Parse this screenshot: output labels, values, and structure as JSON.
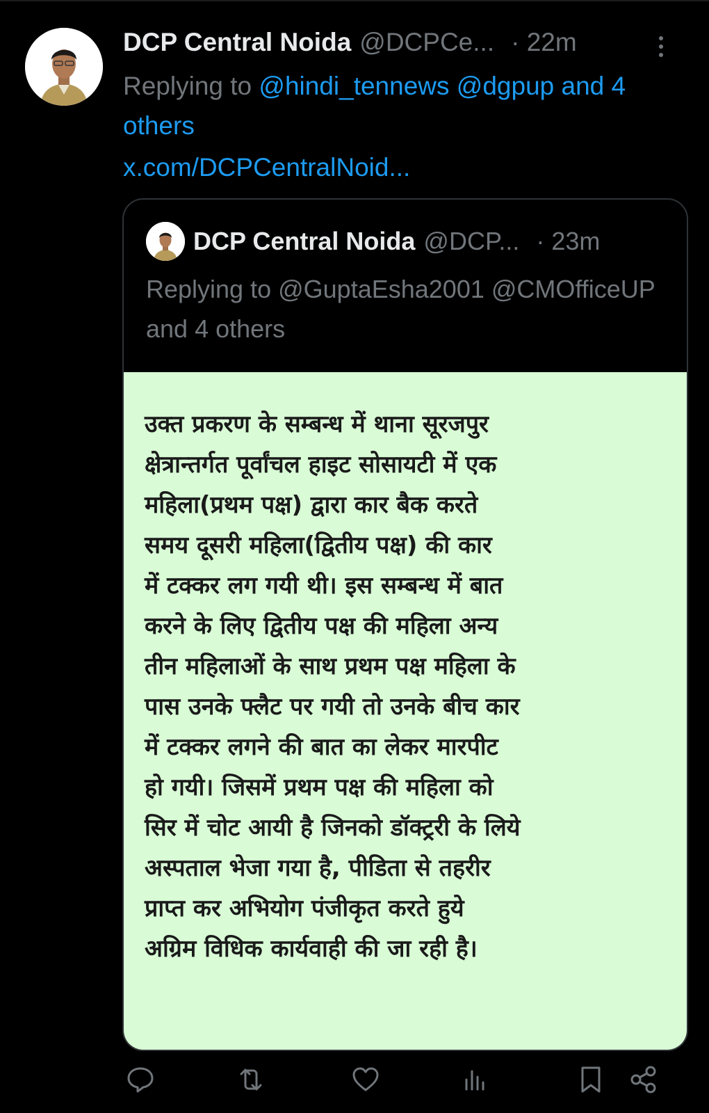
{
  "tweet": {
    "display_name": "DCP Central Noida",
    "handle": "@DCPCe...",
    "time": "· 22m",
    "reply_prefix": "Replying to ",
    "reply_mentions": "@hindi_tennews @dgpup and 4 others",
    "link_text": "x.com/DCPCentralNoid..."
  },
  "quote": {
    "display_name": "DCP Central Noida",
    "handle": "@DCP...",
    "time": "· 23m",
    "reply_text": "Replying to @GuptaEsha2001 @CMOfficeUP and 4 others",
    "image_text_lines": [
      "उक्त प्रकरण के सम्बन्ध में थाना सूरजपुर",
      "क्षेत्रान्तर्गत पूर्वांचल हाइट सोसायटी में एक",
      "महिला(प्रथम पक्ष) द्वारा कार बैक करते",
      "समय दूसरी महिला(द्वितीय पक्ष) की कार",
      "में टक्कर लग गयी थी। इस सम्बन्ध में बात",
      "करने के लिए द्वितीय पक्ष की महिला अन्य",
      "तीन महिलाओं के साथ प्रथम पक्ष महिला के",
      "पास उनके फ्लैट पर गयी तो उनके बीच कार",
      "में टक्कर लगने की बात का लेकर मारपीट",
      "हो गयी। जिसमें प्रथम पक्ष की महिला को",
      "सिर में चोट आयी है जिनको डॉक्ट्ररी के लिये",
      "अस्पताल भेजा गया है, पीडिता से तहरीर",
      "प्राप्त कर अभियोग पंजीकृत करते हुये",
      "अग्रिम विधिक कार्यवाही की जा रही है।"
    ]
  },
  "actions": [
    {
      "icon": "reply-icon"
    },
    {
      "icon": "retweet-icon"
    },
    {
      "icon": "like-icon"
    },
    {
      "icon": "views-icon"
    },
    {
      "icon": "bookmark-icon"
    },
    {
      "icon": "share-icon"
    }
  ],
  "colors": {
    "background": "#000000",
    "text_primary": "#e7e9ea",
    "text_secondary": "#71767b",
    "link": "#1d9bf0",
    "card_border": "#2f3336",
    "image_background": "#d9fcd6"
  }
}
